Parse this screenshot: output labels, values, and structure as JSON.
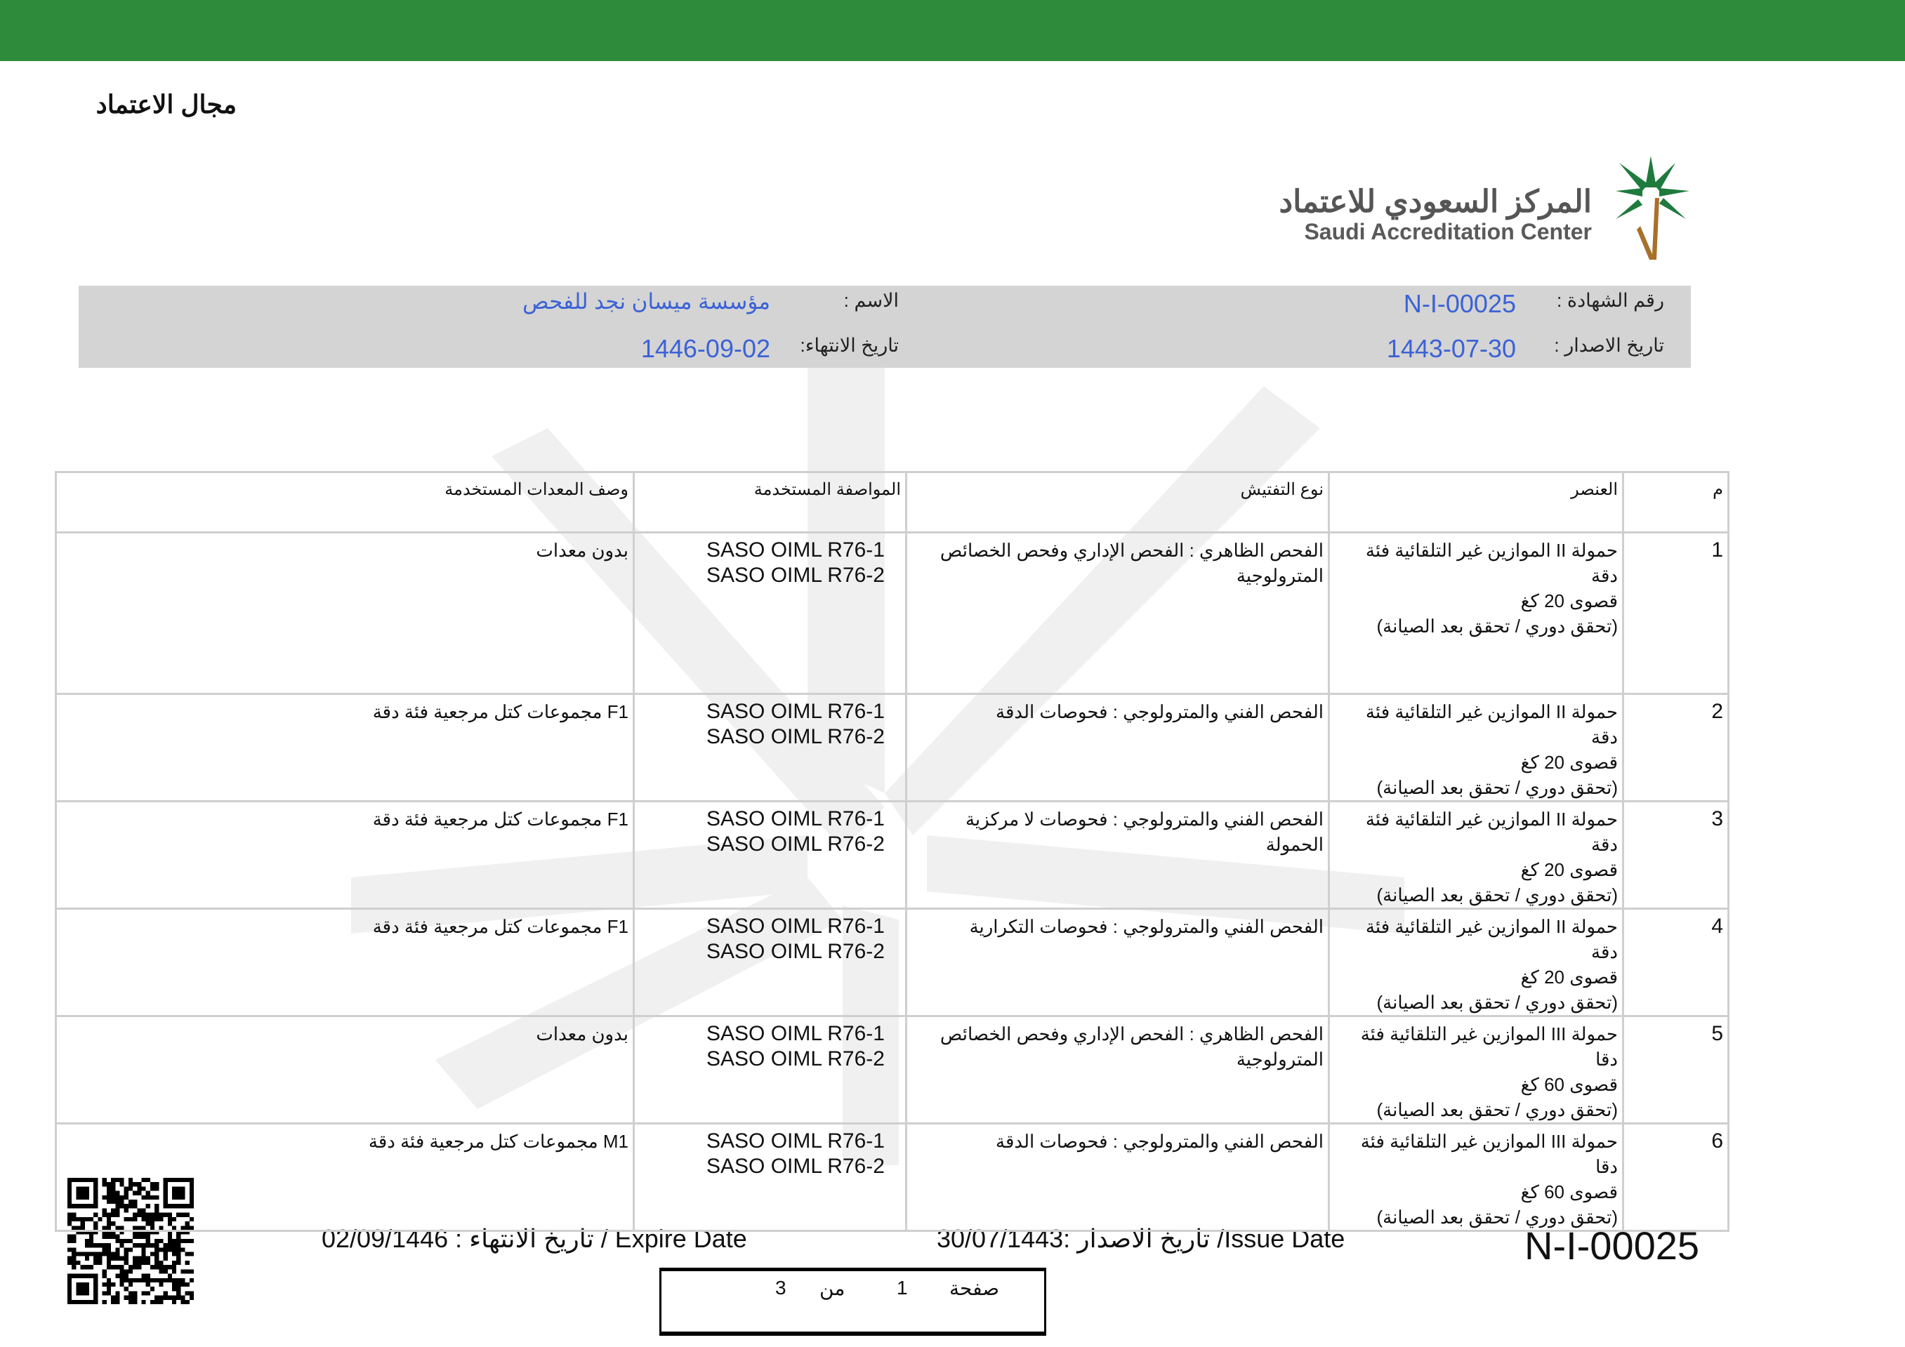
{
  "page_title": "مجال الاعتماد",
  "logo": {
    "arabic": "المركز السعودي للاعتماد",
    "english": "Saudi Accreditation Center"
  },
  "info": {
    "certificate_label": "رقم الشهادة :",
    "certificate_number": "N-I-00025",
    "issue_label": "تاريخ الاصدار :",
    "issue_date": "1443-07-30",
    "name_label": "الاسم :",
    "name_value": "مؤسسة ميسان نجد للفحص",
    "expiry_label": "تاريخ الانتهاء:",
    "expiry_date": "1446-09-02"
  },
  "table": {
    "headers": [
      "م",
      "العنصر",
      "نوع التفتيش",
      "المواصفة المستخدمة",
      "وصف المعدات المستخدمة"
    ],
    "rows": [
      {
        "no": "1",
        "item": "حمولة  II الموازين غير التلقائية فئة دقة\nقصوى 20 كغ\n(تحقق دوري / تحقق بعد الصيانة)",
        "type": "الفحص الظاهري : الفحص الإداري وفحص الخصائص المترولوجية",
        "standard": "SASO OIML R76-1\nSASO OIML R76-2",
        "equipment": "بدون معدات"
      },
      {
        "no": "2",
        "item": "حمولة  II الموازين غير التلقائية فئة دقة\nقصوى 20 كغ\n(تحقق دوري / تحقق بعد الصيانة)",
        "type": "الفحص الفني والمترولوجي : فحوصات الدقة",
        "standard": "SASO OIML R76-1\nSASO OIML R76-2",
        "equipment": "F1 مجموعات كتل مرجعية فئة دقة"
      },
      {
        "no": "3",
        "item": "حمولة  II الموازين غير التلقائية فئة دقة\nقصوى 20 كغ\n(تحقق دوري / تحقق بعد الصيانة)",
        "type": "الفحص الفني والمترولوجي : فحوصات لا مركزية الحمولة",
        "standard": "SASO OIML R76-1\nSASO OIML R76-2",
        "equipment": "F1 مجموعات كتل مرجعية فئة دقة"
      },
      {
        "no": "4",
        "item": "حمولة  II الموازين غير التلقائية فئة دقة\nقصوى 20 كغ\n(تحقق دوري / تحقق بعد الصيانة)",
        "type": "الفحص الفني والمترولوجي : فحوصات التكرارية",
        "standard": "SASO OIML R76-1\nSASO OIML R76-2",
        "equipment": "F1 مجموعات كتل مرجعية فئة دقة"
      },
      {
        "no": "5",
        "item": "حمولة  III الموازين غير التلقائية فئة دقا\nقصوى 60 كغ\n(تحقق دوري / تحقق بعد الصيانة)",
        "type": "الفحص الظاهري : الفحص الإداري وفحص الخصائص المترولوجية",
        "standard": "SASO OIML R76-1\nSASO OIML R76-2",
        "equipment": "بدون معدات"
      },
      {
        "no": "6",
        "item": "حمولة  III الموازين غير التلقائية فئة دقا\nقصوى 60 كغ\n(تحقق دوري / تحقق بعد الصيانة)",
        "type": "الفحص الفني والمترولوجي : فحوصات الدقة",
        "standard": "SASO OIML R76-1\nSASO OIML R76-2",
        "equipment": "M1 مجموعات كتل مرجعية فئة دقة"
      }
    ]
  },
  "footer": {
    "expire_text": "02/09/1446 : تاريخ الانتهاء / Expire Date",
    "issue_text": "30/07/1443: تاريخ الاصدار /Issue Date",
    "certificate_number": "N-I-00025",
    "page_label": "صفحة",
    "page_current": "1",
    "page_of": "من",
    "page_total": "3"
  },
  "colors": {
    "top_bar": "#2f8b3c",
    "value_text": "#3b62d6",
    "band": "#d4d4d4"
  }
}
